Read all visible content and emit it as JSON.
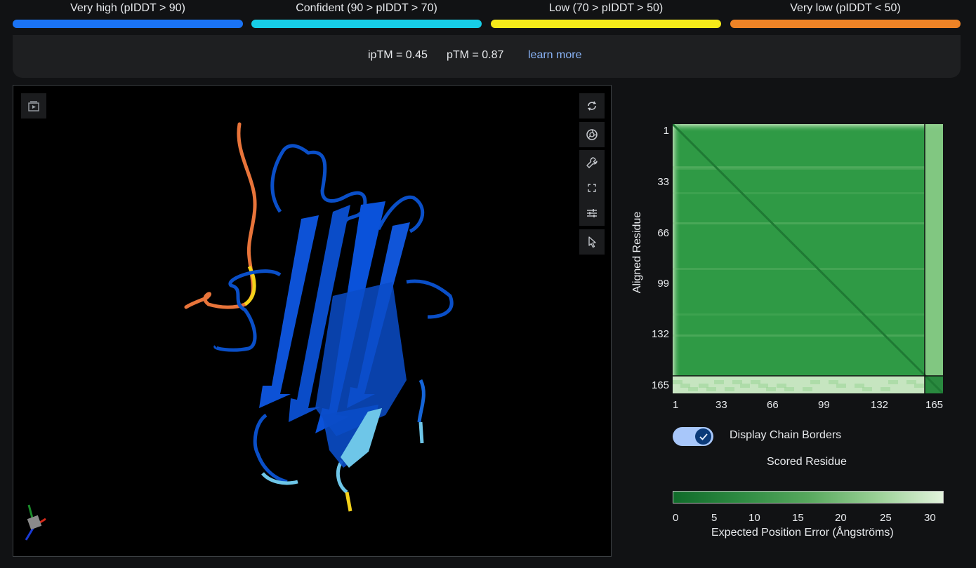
{
  "legend": [
    {
      "label": "Very high (pIDDT > 90)",
      "color": "#1a73f5"
    },
    {
      "label": "Confident (90 > pIDDT > 70)",
      "color": "#17cde7"
    },
    {
      "label": "Low (70 > pIDDT > 50)",
      "color": "#f5ea1a"
    },
    {
      "label": "Very low (pIDDT < 50)",
      "color": "#ee8326"
    }
  ],
  "metrics": {
    "iptm": "ipTM = 0.45",
    "ptm": "pTM = 0.87",
    "learn_more": "learn more"
  },
  "viewer": {
    "left_tools": [
      "screenshot-play-icon"
    ],
    "right_tools": [
      "rotate-icon",
      "camera-shutter-icon",
      "wrench-icon",
      "fullscreen-icon",
      "sliders-icon",
      "pointer-icon"
    ]
  },
  "pae": {
    "y_axis_label": "Aligned Residue",
    "y_ticks": [
      "1",
      "33",
      "66",
      "99",
      "132",
      "165"
    ],
    "x_ticks": [
      "1",
      "33",
      "66",
      "99",
      "132",
      "165"
    ],
    "x_axis_label": "Scored Residue",
    "chain_border_residue": 155,
    "total_residues": 166
  },
  "toggle": {
    "label": "Display Chain Borders",
    "checked": true
  },
  "colorbar": {
    "ticks": [
      "0",
      "5",
      "10",
      "15",
      "20",
      "25",
      "30"
    ],
    "title": "Expected Position Error (Ångströms)",
    "min": 0,
    "max": 31
  }
}
